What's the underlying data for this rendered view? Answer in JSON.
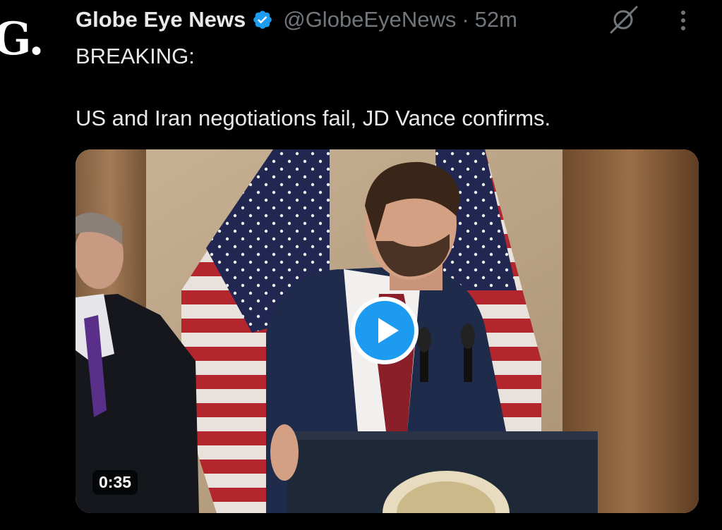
{
  "post": {
    "avatar_letter": "G.",
    "display_name": "Globe Eye News",
    "handle": "@GlobeEyeNews",
    "separator": "·",
    "timestamp": "52m",
    "text": "BREAKING:\n\nUS and Iran negotiations fail, JD Vance confirms.",
    "verified": true
  },
  "media": {
    "type": "video",
    "duration": "0:35"
  },
  "icons": {
    "verified": "verified-badge-icon",
    "grok": "grok-icon",
    "more": "more-vertical-icon",
    "play": "play-icon"
  },
  "colors": {
    "background": "#000000",
    "text": "#e7e9ea",
    "secondary": "#71767b",
    "accent": "#1d9bf0"
  }
}
